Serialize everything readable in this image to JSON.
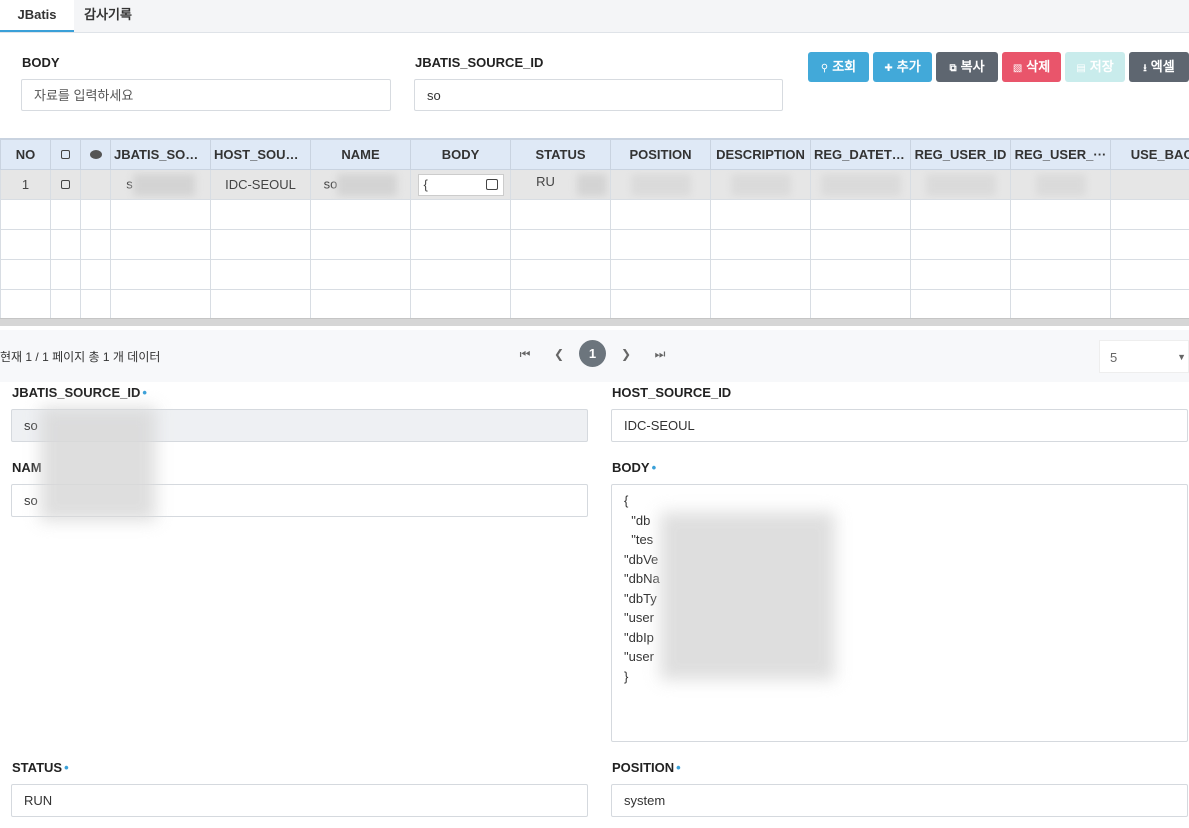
{
  "tabs": [
    {
      "label": "JBatis"
    },
    {
      "label": "감사기록"
    }
  ],
  "search": {
    "body_label": "BODY",
    "body_placeholder": "자료를 입력하세요",
    "source_label": "JBATIS_SOURCE_ID",
    "source_value": "so"
  },
  "toolbar": {
    "search": "조회",
    "add": "추가",
    "copy": "복사",
    "delete": "삭제",
    "save": "저장",
    "excel": "엑셀"
  },
  "grid": {
    "headers": [
      "NO",
      "",
      "",
      "JBATIS_SOU···",
      "HOST_SOUR···",
      "NAME",
      "BODY",
      "STATUS",
      "POSITION",
      "DESCRIPTION",
      "REG_DATETI···",
      "REG_USER_ID",
      "REG_USER_···",
      "USE_BACKUP"
    ],
    "row": {
      "no": "1",
      "jbatis_source": "s",
      "host_source": "IDC-SEOUL",
      "name": "so",
      "body": "{",
      "status": "RU"
    }
  },
  "pager": {
    "info": "현재 1 / 1 페이지 총 1 개 데이터",
    "current": "1",
    "page_size": "5"
  },
  "form": {
    "jbatis_source_id_label": "JBATIS_SOURCE_ID",
    "jbatis_source_id_value": "so",
    "host_source_id_label": "HOST_SOURCE_ID",
    "host_source_id_value": "IDC-SEOUL",
    "name_label": "NAM",
    "name_value": "so",
    "body_label": "BODY",
    "body_lines": [
      "{",
      "  \"db",
      "  \"tes",
      "\"dbVe",
      "\"dbNa",
      "\"dbTy",
      "\"user",
      "\"dbIp",
      "\"user",
      "}"
    ],
    "status_label": "STATUS",
    "status_value": "RUN",
    "position_label": "POSITION",
    "position_value": "system"
  }
}
